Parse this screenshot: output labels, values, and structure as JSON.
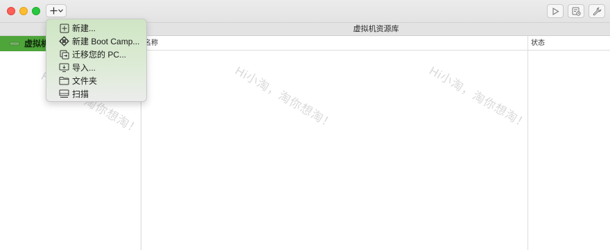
{
  "window": {
    "library_title": "虚拟机资源库"
  },
  "toolbar": {
    "add_icon": "plus-icon",
    "add_dropdown_icon": "chevron-down-icon",
    "right_buttons": [
      "play-icon",
      "snapshot-icon",
      "wrench-icon"
    ]
  },
  "sidebar": {
    "selected_label": "虚拟机",
    "selected_color": "#4ea53a"
  },
  "table": {
    "columns": [
      "名称",
      "状态"
    ]
  },
  "menu": {
    "items": [
      {
        "label": "新建...",
        "icon": "new-vm-icon"
      },
      {
        "label": "新建 Boot Camp...",
        "icon": "bootcamp-icon"
      },
      {
        "label": "迁移您的 PC...",
        "icon": "migrate-pc-icon"
      },
      {
        "label": "导入...",
        "icon": "import-icon"
      },
      {
        "label": "文件夹",
        "icon": "folder-icon"
      },
      {
        "label": "扫描",
        "icon": "scan-icon"
      }
    ]
  },
  "watermark": {
    "text": "Hi小淘，淘你想淘！"
  }
}
